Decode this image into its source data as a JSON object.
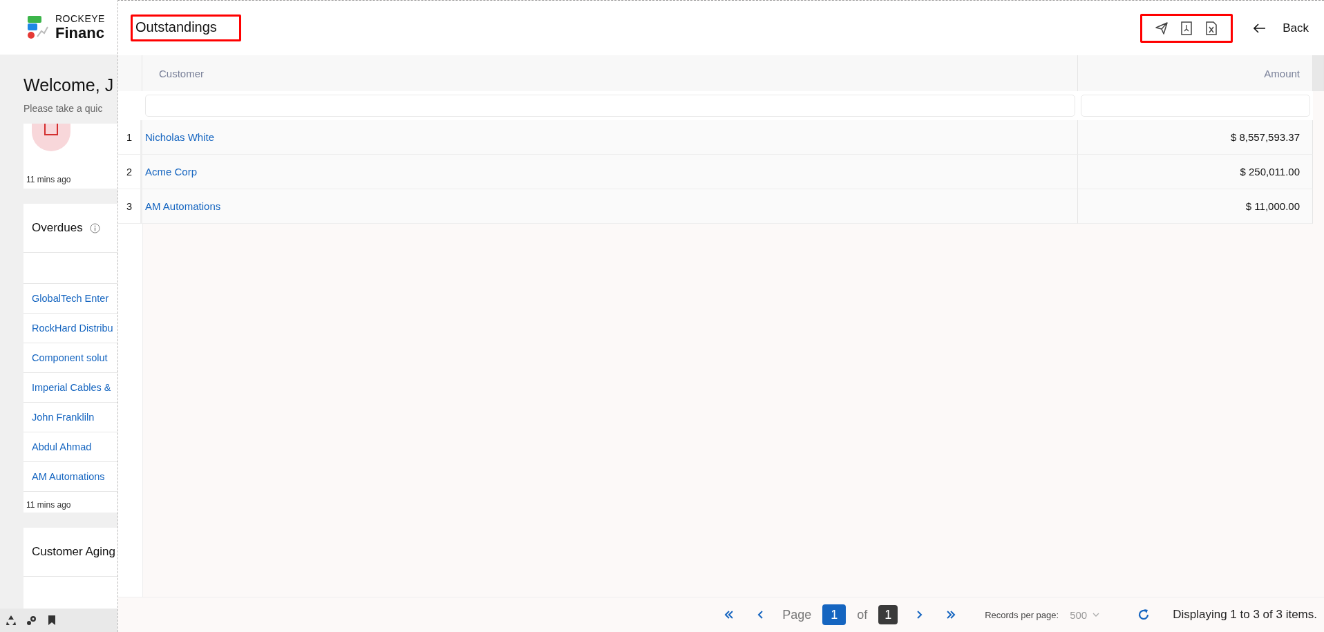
{
  "dashboard": {
    "brand": "ROCKEYE",
    "app_name": "Financ",
    "welcome": "Welcome, J",
    "subtitle": "Please take a quic",
    "summary_card": {
      "updated": "11 mins ago"
    },
    "overdues_card": {
      "title": "Overdues",
      "items": [
        "GlobalTech Enter",
        "RockHard Distribu",
        "Component solut",
        "Imperial Cables &",
        "John Frankliln",
        "Abdul Ahmad",
        "AM Automations"
      ],
      "updated": "11 mins ago"
    },
    "aging_card": {
      "title": "Customer Aging"
    }
  },
  "panel": {
    "title": "Outstandings",
    "title_highlighted": true,
    "toolbar": [
      {
        "kind": "send"
      },
      {
        "kind": "pdf"
      },
      {
        "kind": "excel"
      }
    ],
    "toolbar_highlighted": true,
    "back": "Back"
  },
  "table": {
    "columns": [
      "Customer",
      "Amount"
    ],
    "rows": [
      {
        "number": "1",
        "customer": "Nicholas White",
        "amount": "$ 8,557,593.37"
      },
      {
        "number": "2",
        "customer": "Acme Corp",
        "amount": "$ 250,011.00"
      },
      {
        "number": "3",
        "customer": "AM Automations",
        "amount": "$ 11,000.00"
      }
    ]
  },
  "pagination": {
    "page_label": "Page",
    "current_page": "1",
    "of_label": "of",
    "total_pages": "1",
    "records_label": "Records per page:",
    "records_value": "500",
    "status": "Displaying 1 to 3 of 3 items."
  }
}
